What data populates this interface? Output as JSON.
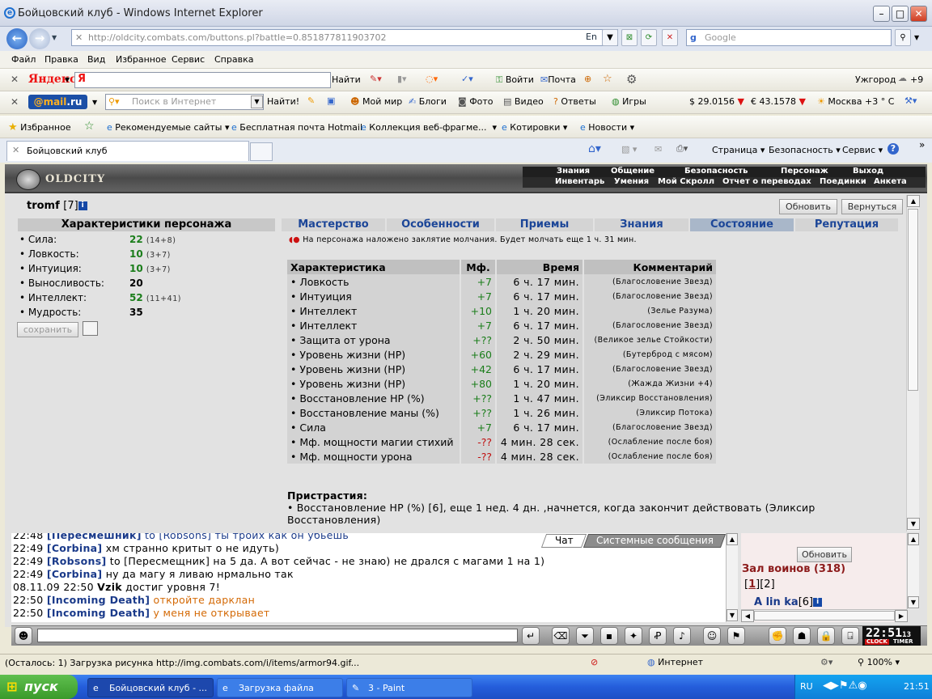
{
  "window": {
    "title": "Бойцовский клуб - Windows Internet Explorer"
  },
  "nav": {
    "url": "http://oldcity.combats.com/buttons.pl?battle=0.851877811903702",
    "lang": "En",
    "search_placeholder": "Google"
  },
  "menu": [
    "Файл",
    "Правка",
    "Вид",
    "Избранное",
    "Сервис",
    "Справка"
  ],
  "yandex": {
    "logo": "Яндекс",
    "find": "Найти",
    "login": "Войти",
    "mail": "Почта",
    "city": "Ужгород",
    "temp": "+9"
  },
  "mailru": {
    "logo_pre": "@mail",
    "logo_post": ".ru",
    "placeholder": "Поиск в Интернет",
    "find": "Найти!",
    "items": [
      "Мой мир",
      "Блоги",
      "Фото",
      "Видео",
      "Ответы",
      "Игры"
    ],
    "usd": "$ 29.0156",
    "eur": "€ 43.1578",
    "weather": "Москва +3 ° C"
  },
  "favorites": {
    "fav": "Избранное",
    "items": [
      "Рекомендуемые сайты",
      "Бесплатная почта Hotmail",
      "Коллекция веб-фрагме...",
      "Котировки",
      "Новости"
    ]
  },
  "tabs": {
    "active": "Бойцовский клуб",
    "page": "Страница",
    "security": "Безопасность",
    "tools": "Сервис"
  },
  "game": {
    "logo": "OLDCITY",
    "nav_top": [
      "Знания",
      "Общение",
      "Безопасность",
      "Персонаж",
      "Выход"
    ],
    "nav_bottom": [
      "Инвентарь",
      "Умения",
      "Мой Скролл",
      "Отчет о переводах",
      "Поединки",
      "Анкета"
    ],
    "player": "tromf",
    "level": "[7]",
    "refresh": "Обновить",
    "back": "Вернуться",
    "char_title": "Характеристики персонажа",
    "stats": [
      {
        "name": "• Сила:",
        "value": "22",
        "bonus": "(14+8)",
        "green": true
      },
      {
        "name": "• Ловкость:",
        "value": "10",
        "bonus": "(3+7)",
        "green": true
      },
      {
        "name": "• Интуиция:",
        "value": "10",
        "bonus": "(3+7)",
        "green": true
      },
      {
        "name": "• Выносливость:",
        "value": "20",
        "bonus": "",
        "green": false
      },
      {
        "name": "• Интеллект:",
        "value": "52",
        "bonus": "(11+41)",
        "green": true
      },
      {
        "name": "• Мудрость:",
        "value": "35",
        "bonus": "",
        "green": false
      }
    ],
    "save": "сохранить",
    "section_tabs": [
      "Мастерство",
      "Особенности",
      "Приемы",
      "Знания",
      "Состояние",
      "Репутация"
    ],
    "active_tab": "Состояние",
    "silence": "На персонажа наложено заклятие молчания. Будет молчать еще 1 ч. 31 мин.",
    "effects_headers": [
      "Характеристика",
      "Мф.",
      "Время",
      "Комментарий"
    ],
    "effects": [
      [
        "• Ловкость",
        "+7",
        "6 ч. 17 мин.",
        "(Благословение Звезд)"
      ],
      [
        "• Интуиция",
        "+7",
        "6 ч. 17 мин.",
        "(Благословение Звезд)"
      ],
      [
        "• Интеллект",
        "+10",
        "1 ч. 20 мин.",
        "(Зелье Разума)"
      ],
      [
        "• Интеллект",
        "+7",
        "6 ч. 17 мин.",
        "(Благословение Звезд)"
      ],
      [
        "• Защита от урона",
        "+??",
        "2 ч. 50 мин.",
        "(Великое зелье Стойкости)"
      ],
      [
        "• Уровень жизни (HP)",
        "+60",
        "2 ч. 29 мин.",
        "(Бутерброд с мясом)"
      ],
      [
        "• Уровень жизни (HP)",
        "+42",
        "6 ч. 17 мин.",
        "(Благословение Звезд)"
      ],
      [
        "• Уровень жизни (HP)",
        "+80",
        "1 ч. 20 мин.",
        "(Жажда Жизни +4)"
      ],
      [
        "• Восстановление HP (%)",
        "+??",
        "1 ч. 47 мин.",
        "(Эликсир Восстановления)"
      ],
      [
        "• Восстановление маны (%)",
        "+??",
        "1 ч. 26 мин.",
        "(Эликсир Потока)"
      ],
      [
        "• Сила",
        "+7",
        "6 ч. 17 мин.",
        "(Благословение Звезд)"
      ],
      [
        "• Мф. мощности магии стихий",
        "-??",
        "4 мин. 28 сек.",
        "(Ослабление после боя)"
      ],
      [
        "• Мф. мощности урона",
        "-??",
        "4 мин. 28 сек.",
        "(Ослабление после боя)"
      ]
    ],
    "addict_title": "Пристрастия:",
    "addict_text": "• Восстановление HP (%) [6], еще 1 нед. 4 дн. ,начнется, когда закончит действовать (Эликсир Восстановления)"
  },
  "chat": {
    "tab_chat": "Чат",
    "tab_system": "Системные сообщения",
    "lines": [
      {
        "t": "22:48",
        "nick": "[Пересмешник]",
        "msg": " to [Robsons] ты троих как он убьешь",
        "style": "blue"
      },
      {
        "t": "22:49",
        "nick": "[Corbina]",
        "msg": " хм странно критыт о не идуть)",
        "style": "normal"
      },
      {
        "t": "22:49",
        "nick": "[Robsons]",
        "msg": " to [Пересмещник] на 5 да. А вот сейчас - не знаю) не дрался с магами 1 на 1)",
        "style": "normal"
      },
      {
        "t": "22:49",
        "nick": "[Corbina]",
        "msg": " ну да магу я ливаю нрмально так",
        "style": "normal"
      },
      {
        "t": "08.11.09 22:50",
        "nick": "Vzik",
        "msg": " достиг уровня 7!",
        "style": "sys"
      },
      {
        "t": "22:50",
        "nick": "[Incoming Death]",
        "msg": " откройте дарклан",
        "style": "orange"
      },
      {
        "t": "22:50",
        "nick": "[Incoming Death]",
        "msg": " у меня не открывает",
        "style": "orange"
      }
    ]
  },
  "room": {
    "refresh": "Обновить",
    "title": "Зал воинов (318)",
    "pages": [
      "1",
      "2"
    ],
    "user": "A lin ka",
    "user_level": "[6]"
  },
  "clock": {
    "time": "22:51",
    "sec": "13",
    "clock_label": "CLOCK",
    "timer_label": "TIMER"
  },
  "status": {
    "text": "(Осталось: 1) Загрузка рисунка http://img.combats.com/i/items/armor94.gif...",
    "zone": "Интернет",
    "zoom": "100%"
  },
  "taskbar": {
    "start": "пуск",
    "tasks": [
      "Бойцовский клуб - ...",
      "Загрузка файла",
      "3 - Paint"
    ],
    "lang": "RU",
    "time": "21:51"
  }
}
